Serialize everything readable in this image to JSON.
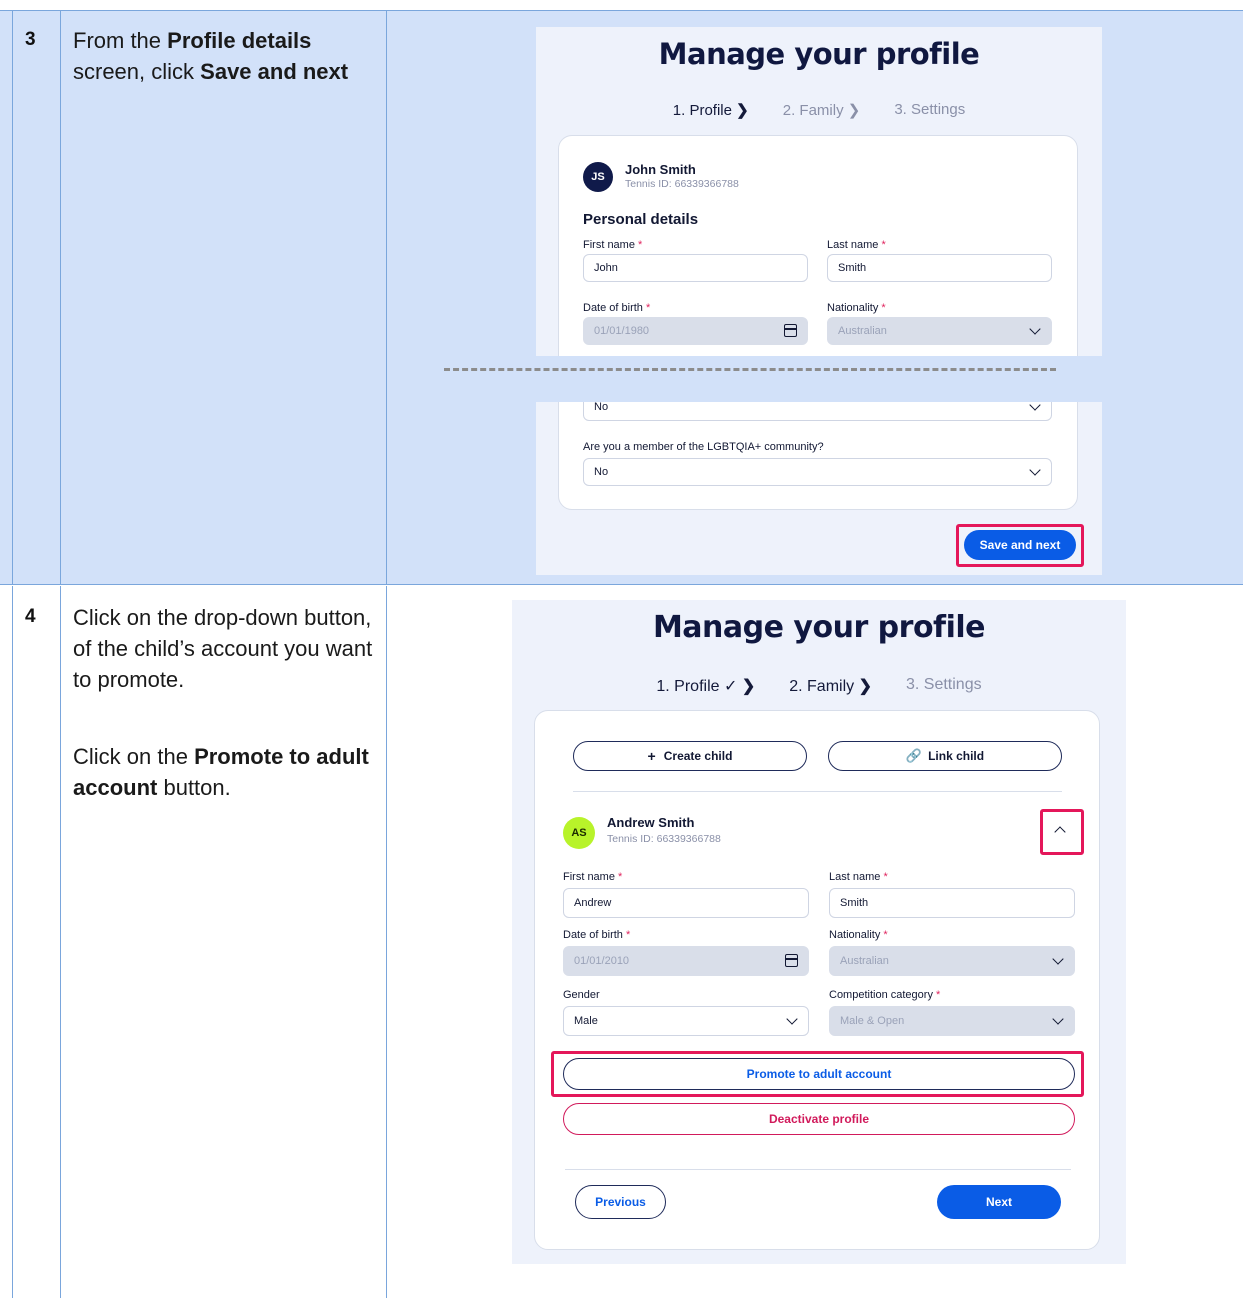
{
  "step3": {
    "number": "3",
    "lines": [
      "From the ",
      "Profile details",
      " screen, click ",
      "Save and next"
    ],
    "shot": {
      "title": "Manage your profile",
      "steps": [
        "1. Profile",
        "2. Family",
        "3. Settings"
      ],
      "user": {
        "initials": "JS",
        "name": "John Smith",
        "tennis_id": "Tennis ID: 66339366788"
      },
      "section": "Personal details",
      "first_name": {
        "label": "First name",
        "value": "John"
      },
      "last_name": {
        "label": "Last name",
        "value": "Smith"
      },
      "dob": {
        "label": "Date of birth",
        "value": "01/01/1980"
      },
      "nationality": {
        "label": "Nationality",
        "value": "Australian"
      },
      "hidden_select_value": "No",
      "lgbt": {
        "label": "Are you a member of the LGBTQIA+ community?",
        "value": "No"
      },
      "save_label": "Save and next"
    }
  },
  "step4": {
    "number": "4",
    "para1": "Click on the drop-down button, of the child’s account you want to promote.",
    "para2_pre": "Click on the ",
    "para2_bold": "Promote to adult account",
    "para2_post": " button.",
    "shot": {
      "title": "Manage your profile",
      "steps": [
        "1. Profile",
        "2. Family",
        "3. Settings"
      ],
      "create_child": "Create child",
      "link_child": "Link child",
      "user": {
        "initials": "AS",
        "name": "Andrew Smith",
        "tennis_id": "Tennis ID: 66339366788"
      },
      "first_name": {
        "label": "First name",
        "value": "Andrew"
      },
      "last_name": {
        "label": "Last name",
        "value": "Smith"
      },
      "dob": {
        "label": "Date of birth",
        "value": "01/01/2010"
      },
      "nationality": {
        "label": "Nationality",
        "value": "Australian"
      },
      "gender": {
        "label": "Gender",
        "value": "Male"
      },
      "competition": {
        "label": "Competition category",
        "value": "Male & Open"
      },
      "promote_label": "Promote to adult account",
      "deactivate_label": "Deactivate profile",
      "previous_label": "Previous",
      "next_label": "Next"
    }
  },
  "colors": {
    "accent": "#0a5ce6",
    "highlight": "#e4175a",
    "danger": "#d11a5b",
    "row_bg": "#d2e1f9"
  }
}
